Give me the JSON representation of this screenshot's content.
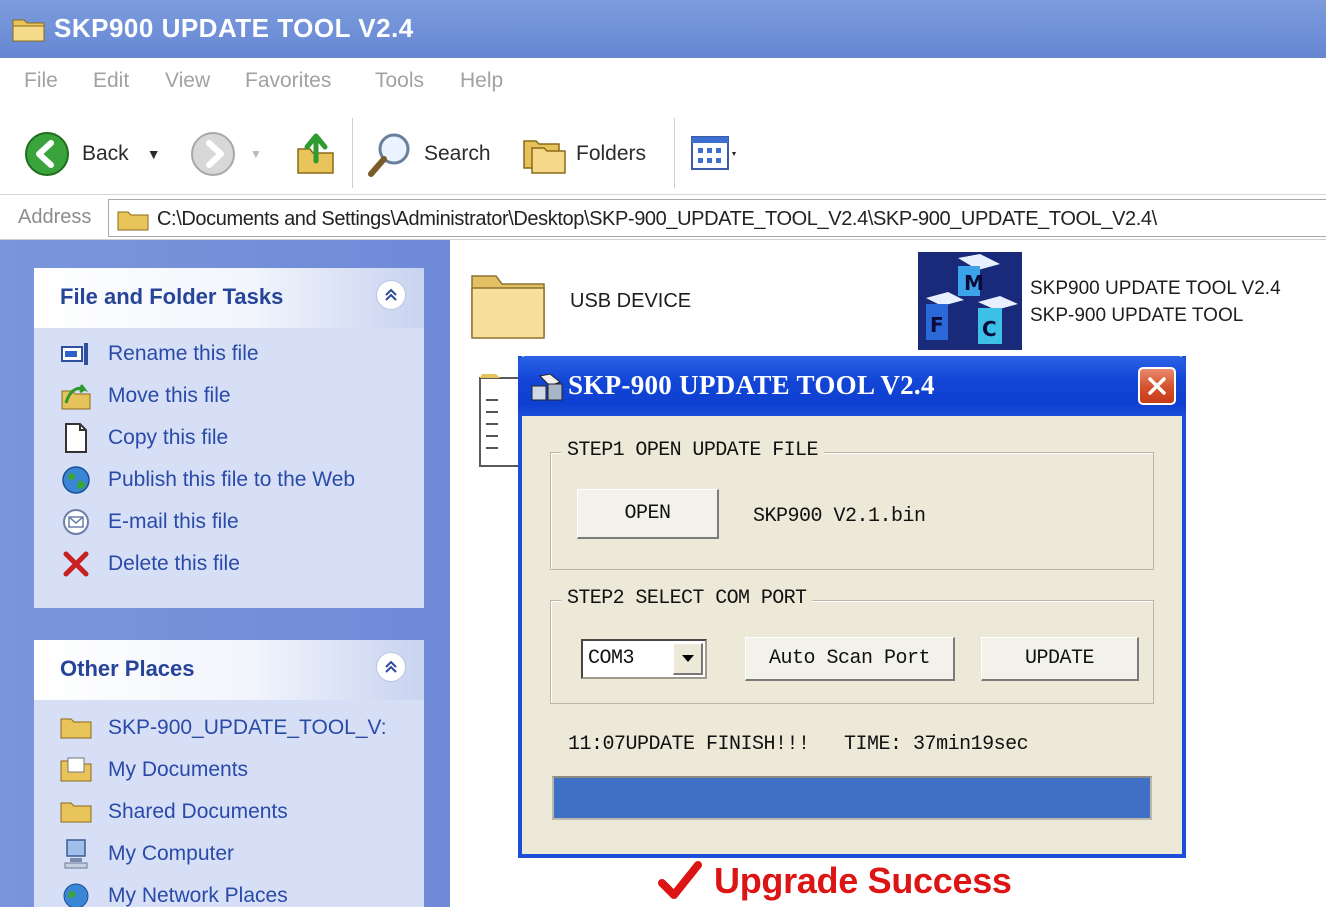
{
  "window": {
    "title": "SKP900 UPDATE TOOL V2.4"
  },
  "menu": [
    "File",
    "Edit",
    "View",
    "Favorites",
    "Tools",
    "Help"
  ],
  "toolbar": {
    "back_label": "Back",
    "search_label": "Search",
    "folders_label": "Folders"
  },
  "address": {
    "label": "Address",
    "path": "C:\\Documents and Settings\\Administrator\\Desktop\\SKP-900_UPDATE_TOOL_V2.4\\SKP-900_UPDATE_TOOL_V2.4\\"
  },
  "file_folder_tasks": {
    "title": "File and Folder Tasks",
    "items": [
      {
        "label": "Rename this file",
        "icon": "rename-icon"
      },
      {
        "label": "Move this file",
        "icon": "move-icon"
      },
      {
        "label": "Copy this file",
        "icon": "copy-icon"
      },
      {
        "label": "Publish this file to the Web",
        "icon": "globe-icon"
      },
      {
        "label": "E-mail this file",
        "icon": "email-icon"
      },
      {
        "label": "Delete this file",
        "icon": "delete-icon"
      }
    ]
  },
  "other_places": {
    "title": "Other Places",
    "items": [
      {
        "label": "SKP-900_UPDATE_TOOL_V:",
        "icon": "folder-icon"
      },
      {
        "label": "My Documents",
        "icon": "my-documents-icon"
      },
      {
        "label": "Shared Documents",
        "icon": "folder-icon"
      },
      {
        "label": "My Computer",
        "icon": "my-computer-icon"
      },
      {
        "label": "My Network Places",
        "icon": "network-icon"
      }
    ]
  },
  "files": {
    "usb_folder": "USB DEVICE",
    "app_name": "SKP900 UPDATE TOOL V2.4",
    "app_desc": "SKP-900 UPDATE TOOL"
  },
  "dialog": {
    "title": "SKP-900 UPDATE TOOL V2.4",
    "step1_title": "STEP1 OPEN UPDATE FILE",
    "open_button": "OPEN",
    "file_name": "SKP900 V2.1.bin",
    "step2_title": "STEP2 SELECT COM PORT",
    "com_port": "COM3",
    "auto_scan_button": "Auto Scan Port",
    "update_button": "UPDATE",
    "status": "11:07UPDATE FINISH!!!   TIME: 37min19sec",
    "progress_percent": 100
  },
  "caption": "Upgrade Success",
  "colors": {
    "xp_blue": "#1c4ed8",
    "panel_title": "#26459a",
    "progress": "#3f70c6",
    "success_red": "#dd1414"
  }
}
